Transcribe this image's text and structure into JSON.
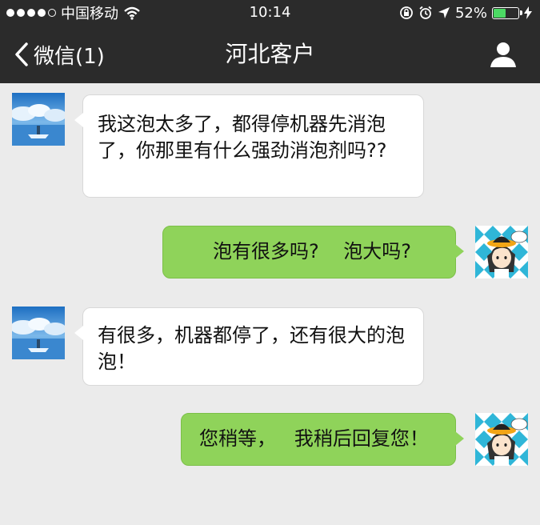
{
  "status_bar": {
    "carrier": "中国移动",
    "time": "10:14",
    "battery": "52%",
    "battery_level": 0.52,
    "battery_color": "#4cd964"
  },
  "nav": {
    "back_label": "微信(1)",
    "title": "河北客户",
    "profile_icon": "person-icon"
  },
  "messages": [
    {
      "side": "in",
      "sender": "customer",
      "text": "我这泡太多了，都得停机器先消泡了，你那里有什么强劲消泡剂吗??"
    },
    {
      "side": "out",
      "sender": "me",
      "text": "泡有很多吗?    泡大吗?"
    },
    {
      "side": "in",
      "sender": "customer",
      "text": "有很多，机器都停了，还有很大的泡泡！"
    },
    {
      "side": "out",
      "sender": "me",
      "text": "您稍等，   我稍后回复您！"
    }
  ],
  "colors": {
    "header_bg": "#2b2b2b",
    "chat_bg": "#ebebeb",
    "incoming_bubble": "#ffffff",
    "outgoing_bubble": "#8fd35a"
  }
}
